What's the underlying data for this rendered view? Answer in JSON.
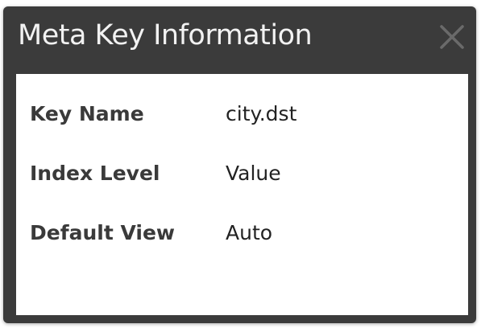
{
  "dialog": {
    "title": "Meta Key Information",
    "close_icon": "close-x-icon"
  },
  "fields": [
    {
      "label": "Key Name",
      "value": "city.dst"
    },
    {
      "label": "Index Level",
      "value": "Value"
    },
    {
      "label": "Default View",
      "value": "Auto"
    }
  ],
  "colors": {
    "titlebar_bg": "#3b3b3b",
    "title_text": "#f2f2f2",
    "content_bg": "#ffffff",
    "close_icon": "#6a6a6a"
  }
}
